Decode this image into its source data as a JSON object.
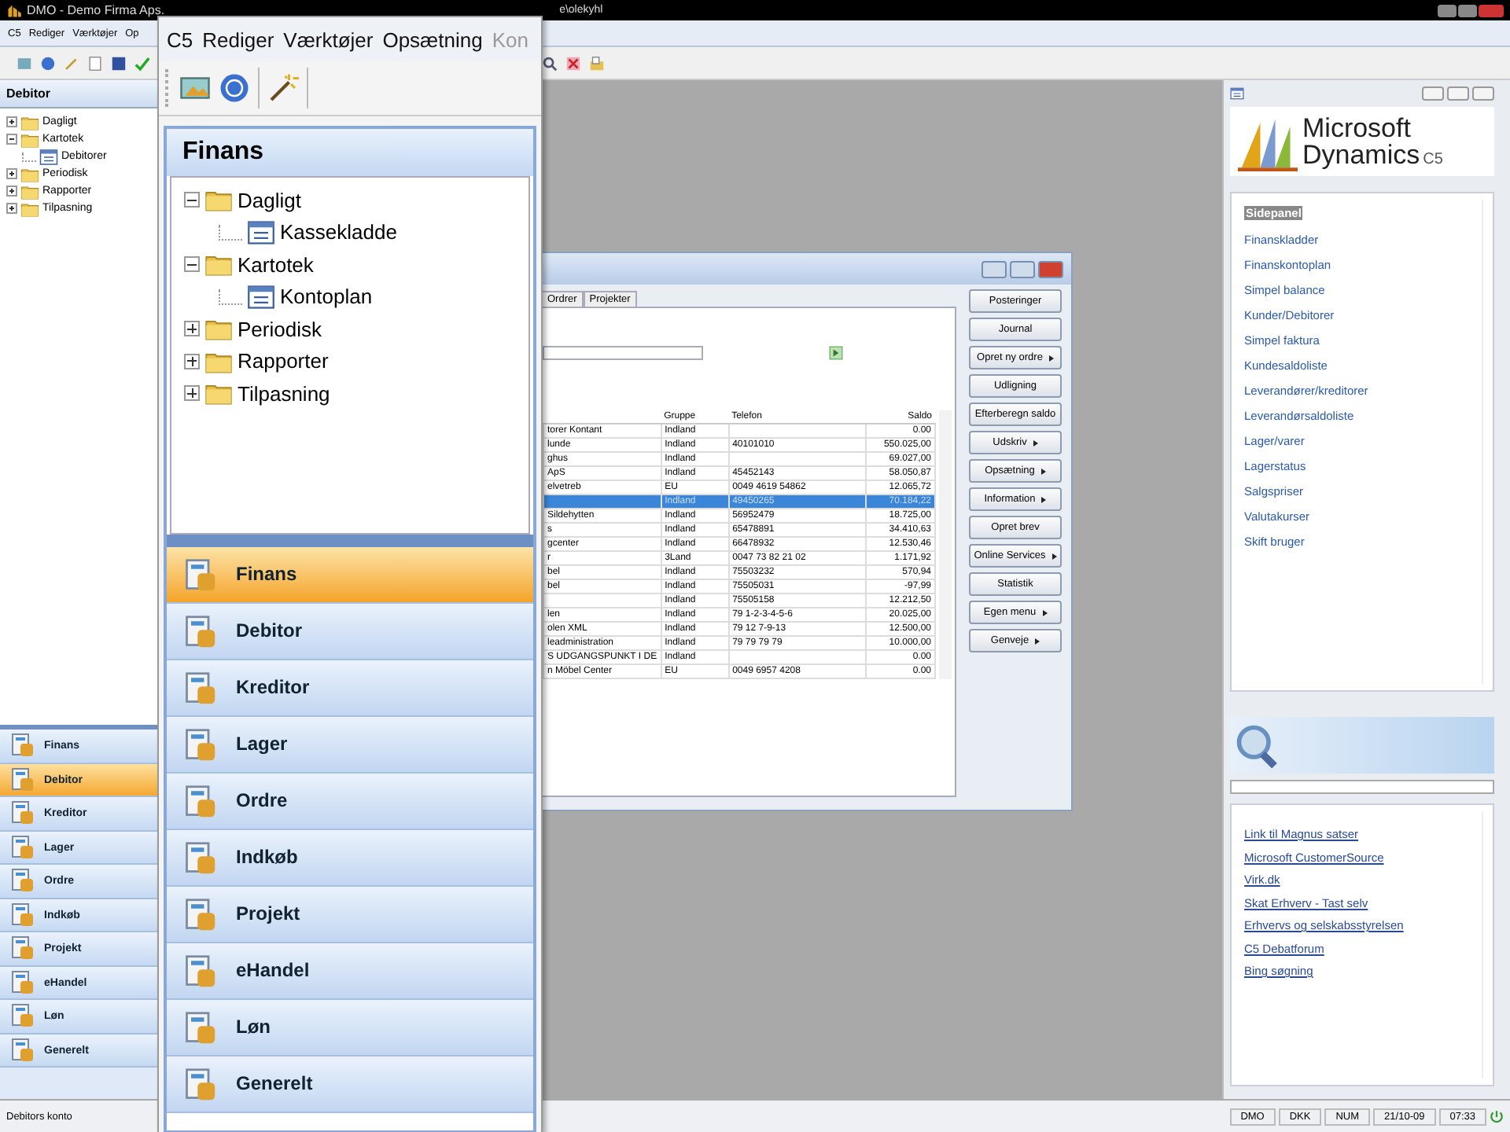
{
  "app": {
    "title": "DMO - Demo Firma Aps.",
    "title_tail": "e\\olekyhl",
    "menu": [
      "C5",
      "Rediger",
      "Værktøjer",
      "Op"
    ],
    "panel_title": "Debitor",
    "tree": [
      {
        "label": "Dagligt",
        "expanded": false
      },
      {
        "label": "Kartotek",
        "expanded": true,
        "children": [
          {
            "label": "Debitorer"
          }
        ]
      },
      {
        "label": "Periodisk",
        "expanded": false
      },
      {
        "label": "Rapporter",
        "expanded": false
      },
      {
        "label": "Tilpasning",
        "expanded": false
      }
    ],
    "nav": [
      {
        "label": "Finans",
        "selected": false
      },
      {
        "label": "Debitor",
        "selected": true
      },
      {
        "label": "Kreditor",
        "selected": false
      },
      {
        "label": "Lager",
        "selected": false
      },
      {
        "label": "Ordre",
        "selected": false
      },
      {
        "label": "Indkøb",
        "selected": false
      },
      {
        "label": "Projekt",
        "selected": false
      },
      {
        "label": "eHandel",
        "selected": false
      },
      {
        "label": "Løn",
        "selected": false
      },
      {
        "label": "Generelt",
        "selected": false
      }
    ],
    "status_text": "Debitors konto",
    "status_fields": [
      "DMO",
      "DKK",
      "NUM",
      "21/10-09",
      "07:33"
    ]
  },
  "dialog": {
    "tabs": [
      {
        "label": "Ordrer",
        "selected": false
      },
      {
        "label": "Projekter",
        "selected": false
      }
    ],
    "columns": [
      "",
      "Gruppe",
      "Telefon",
      "Saldo"
    ],
    "rows": [
      {
        "cells": [
          "torer Kontant",
          "Indland",
          "",
          "0.00"
        ],
        "selected": false
      },
      {
        "cells": [
          "lunde",
          "Indland",
          "40101010",
          "550.025,00"
        ],
        "selected": false
      },
      {
        "cells": [
          "ghus",
          "Indland",
          "",
          "69.027,00"
        ],
        "selected": false
      },
      {
        "cells": [
          "ApS",
          "Indland",
          "45452143",
          "58.050,87"
        ],
        "selected": false
      },
      {
        "cells": [
          "elvetreb",
          "EU",
          "0049 4619 54862",
          "12.065,72"
        ],
        "selected": false
      },
      {
        "cells": [
          "",
          "Indland",
          "49450265",
          "70.184,22"
        ],
        "selected": true
      },
      {
        "cells": [
          "Sildehytten",
          "Indland",
          "56952479",
          "18.725,00"
        ],
        "selected": false
      },
      {
        "cells": [
          "s",
          "Indland",
          "65478891",
          "34.410,63"
        ],
        "selected": false
      },
      {
        "cells": [
          "gcenter",
          "Indland",
          "66478932",
          "12.530,46"
        ],
        "selected": false
      },
      {
        "cells": [
          "r",
          "3Land",
          "0047 73 82 21 02",
          "1.171,92"
        ],
        "selected": false
      },
      {
        "cells": [
          "bel",
          "Indland",
          "75503232",
          "570,94"
        ],
        "selected": false
      },
      {
        "cells": [
          "bel",
          "Indland",
          "75505031",
          "-97,99"
        ],
        "selected": false
      },
      {
        "cells": [
          "",
          "Indland",
          "75505158",
          "12.212,50"
        ],
        "selected": false
      },
      {
        "cells": [
          "len",
          "Indland",
          "79 1-2-3-4-5-6",
          "20.025,00"
        ],
        "selected": false
      },
      {
        "cells": [
          "olen XML",
          "Indland",
          "79 12 7-9-13",
          "12.500,00"
        ],
        "selected": false
      },
      {
        "cells": [
          "leadministration",
          "Indland",
          "79 79 79 79",
          "10.000,00"
        ],
        "selected": false
      },
      {
        "cells": [
          "S UDGANGSPUNKT I DE",
          "Indland",
          "",
          "0.00"
        ],
        "selected": false
      },
      {
        "cells": [
          "n Möbel Center",
          "EU",
          "0049 6957 4208",
          "0.00"
        ],
        "selected": false
      }
    ],
    "buttons": [
      {
        "label": "Posteringer",
        "submenu": false
      },
      {
        "label": "Journal",
        "submenu": false
      },
      {
        "label": "Opret ny ordre",
        "submenu": true
      },
      {
        "label": "Udligning",
        "submenu": false
      },
      {
        "label": "Efterberegn saldo",
        "submenu": false
      },
      {
        "label": "Udskriv",
        "submenu": true
      },
      {
        "label": "Opsætning",
        "submenu": true
      },
      {
        "label": "Information",
        "submenu": true
      },
      {
        "label": "Opret brev",
        "submenu": false
      },
      {
        "label": "Online Services",
        "submenu": true
      },
      {
        "label": "Statistik",
        "submenu": false
      },
      {
        "label": "Egen menu",
        "submenu": true
      },
      {
        "label": "Genveje",
        "submenu": true
      }
    ]
  },
  "sidepanel": {
    "logo": {
      "line1": "Microsoft",
      "line2": "Dynamics",
      "suffix": "C5"
    },
    "heading": "Sidepanel",
    "links": [
      "Finanskladder",
      "Finanskontoplan",
      "Simpel balance",
      "Kunder/Debitorer",
      "Simpel faktura",
      "Kundesaldoliste",
      "Leverandører/kreditorer",
      "Leverandørsaldoliste",
      "Lager/varer",
      "Lagerstatus",
      "Salgspriser",
      "Valutakurser",
      "Skift bruger"
    ],
    "web_links": [
      "Link til Magnus satser",
      "Microsoft CustomerSource",
      "Virk.dk",
      "Skat Erhverv - Tast selv",
      "Erhvervs og selskabsstyrelsen",
      "C5 Debatforum",
      "Bing søgning"
    ]
  },
  "zoom_overlay": {
    "menu": [
      {
        "label": "C5",
        "disabled": false
      },
      {
        "label": "Rediger",
        "disabled": false
      },
      {
        "label": "Værktøjer",
        "disabled": false
      },
      {
        "label": "Opsætning",
        "disabled": false
      },
      {
        "label": "Kon",
        "disabled": true
      }
    ],
    "panel_title": "Finans",
    "tree": [
      {
        "label": "Dagligt",
        "expanded": true,
        "children": [
          {
            "label": "Kassekladde"
          }
        ]
      },
      {
        "label": "Kartotek",
        "expanded": true,
        "children": [
          {
            "label": "Kontoplan"
          }
        ]
      },
      {
        "label": "Periodisk",
        "expanded": false
      },
      {
        "label": "Rapporter",
        "expanded": false
      },
      {
        "label": "Tilpasning",
        "expanded": false
      }
    ],
    "nav": [
      {
        "label": "Finans",
        "selected": true
      },
      {
        "label": "Debitor",
        "selected": false
      },
      {
        "label": "Kreditor",
        "selected": false
      },
      {
        "label": "Lager",
        "selected": false
      },
      {
        "label": "Ordre",
        "selected": false
      },
      {
        "label": "Indkøb",
        "selected": false
      },
      {
        "label": "Projekt",
        "selected": false
      },
      {
        "label": "eHandel",
        "selected": false
      },
      {
        "label": "Løn",
        "selected": false
      },
      {
        "label": "Generelt",
        "selected": false
      }
    ]
  }
}
